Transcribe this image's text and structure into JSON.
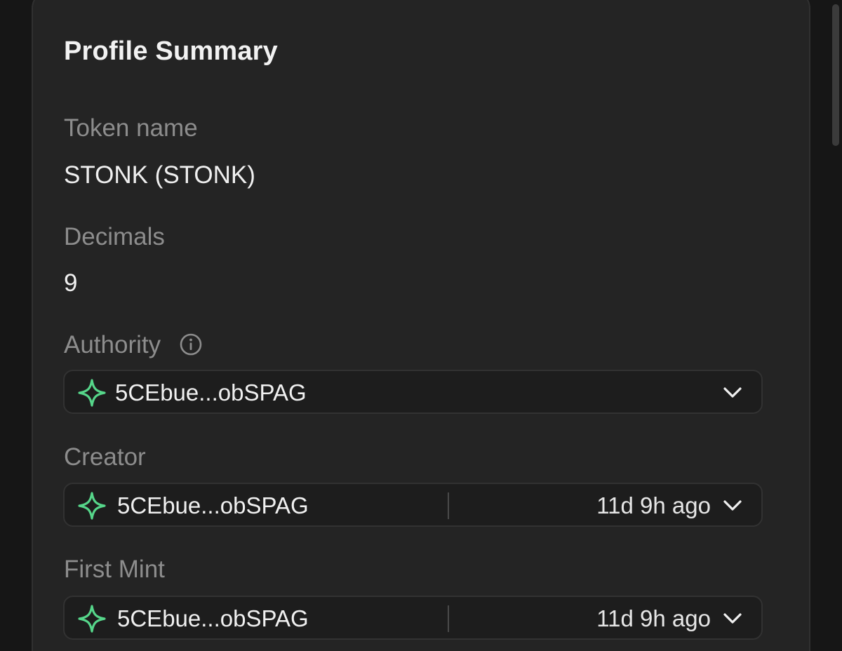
{
  "profile_summary": {
    "title": "Profile Summary",
    "token_name": {
      "label": "Token name",
      "value": "STONK (STONK)"
    },
    "decimals": {
      "label": "Decimals",
      "value": "9"
    },
    "authority": {
      "label": "Authority",
      "address": "5CEbue...obSPAG"
    },
    "creator": {
      "label": "Creator",
      "address": "5CEbue...obSPAG",
      "time": "11d 9h ago"
    },
    "first_mint": {
      "label": "First Mint",
      "address": "5CEbue...obSPAG",
      "time": "11d 9h ago"
    }
  },
  "colors": {
    "accent_star": "#56d68a",
    "background": "#161616",
    "card": "#242424"
  },
  "icons": {
    "info": "info-icon",
    "star": "sparkle-star-icon",
    "chevron": "chevron-down-icon"
  }
}
